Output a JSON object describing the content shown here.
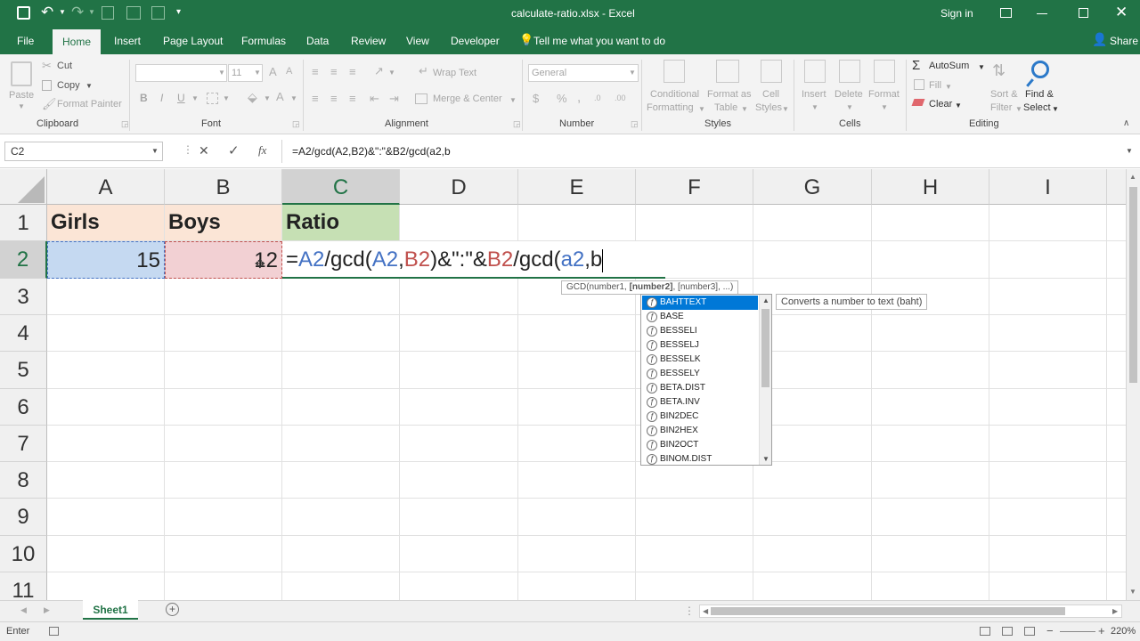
{
  "title_bar": {
    "filename": "calculate-ratio.xlsx",
    "separator": "-",
    "app": "Excel",
    "sign_in": "Sign in",
    "share": "Share"
  },
  "ribbon_tabs": [
    "File",
    "Home",
    "Insert",
    "Page Layout",
    "Formulas",
    "Data",
    "Review",
    "View",
    "Developer"
  ],
  "tell_me": "Tell me what you want to do",
  "ribbon": {
    "clipboard": {
      "paste": "Paste",
      "cut": "Cut",
      "copy": "Copy",
      "format_painter": "Format Painter",
      "label": "Clipboard"
    },
    "font": {
      "font_size": "11",
      "bold": "B",
      "italic": "I",
      "underline": "U",
      "label": "Font"
    },
    "alignment": {
      "wrap_text": "Wrap Text",
      "merge_center": "Merge & Center",
      "label": "Alignment"
    },
    "number": {
      "format": "General",
      "label": "Number"
    },
    "styles": {
      "conditional": "Conditional",
      "formatting": "Formatting",
      "format_as": "Format as",
      "table": "Table",
      "cell": "Cell",
      "cell_styles": "Styles",
      "label": "Styles"
    },
    "cells": {
      "insert": "Insert",
      "delete": "Delete",
      "format": "Format",
      "label": "Cells"
    },
    "editing": {
      "autosum": "AutoSum",
      "fill": "Fill",
      "clear": "Clear",
      "sort": "Sort &",
      "filter": "Filter",
      "find": "Find &",
      "select": "Select",
      "label": "Editing"
    }
  },
  "formula_bar": {
    "name_box": "C2",
    "cancel": "✕",
    "enter": "✓",
    "fx": "fx",
    "content": "=A2/gcd(A2,B2)&\":\"&B2/gcd(a2,b"
  },
  "columns": [
    "A",
    "B",
    "C",
    "D",
    "E",
    "F",
    "G",
    "H",
    "I"
  ],
  "rows": [
    "1",
    "2",
    "3",
    "4",
    "5",
    "6",
    "7",
    "8",
    "9",
    "10",
    "11"
  ],
  "cells": {
    "A1": "Girls",
    "B1": "Boys",
    "C1": "Ratio",
    "A2": "15",
    "B2": "12"
  },
  "cell_formula_parts": [
    "=",
    "A2",
    "/gcd(",
    "A2",
    ",",
    "B2",
    ")&\":\"&",
    "B2",
    "/gcd(",
    "a2",
    ",b"
  ],
  "autocomplete": {
    "tooltip_pre": "GCD(number1, ",
    "tooltip_bold": "[number2]",
    "tooltip_post": ", [number3], ...)",
    "items": [
      "BAHTTEXT",
      "BASE",
      "BESSELI",
      "BESSELJ",
      "BESSELK",
      "BESSELY",
      "BETA.DIST",
      "BETA.INV",
      "BIN2DEC",
      "BIN2HEX",
      "BIN2OCT",
      "BINOM.DIST"
    ],
    "selected_description": "Converts a number to text (baht)"
  },
  "sheet_tabs": [
    "Sheet1"
  ],
  "status": {
    "mode": "Enter",
    "zoom": "220%"
  },
  "colors": {
    "excel_green": "#217346",
    "girls_fill": "#fbe5d6",
    "boys_fill": "#f8e1e1",
    "ratio_fill": "#c6e0b4",
    "a2_fill": "#c5d9f1",
    "b2_fill": "#f2d0d3",
    "ref_blue": "#4472c4",
    "ref_red": "#c0504d"
  }
}
